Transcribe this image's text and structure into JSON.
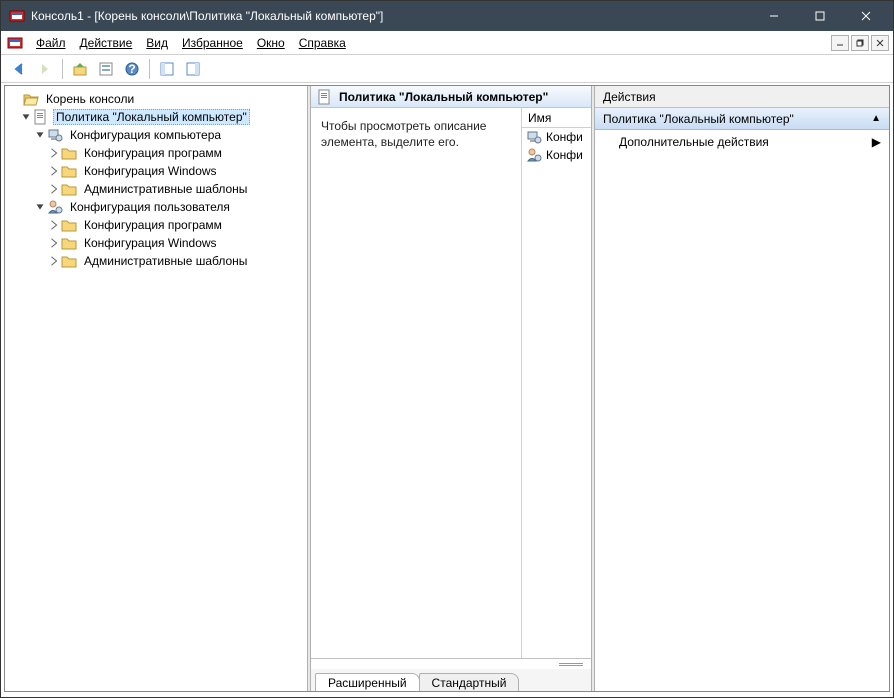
{
  "window": {
    "title": "Консоль1 - [Корень консоли\\Политика \"Локальный компьютер\"]"
  },
  "menu": {
    "file": "Файл",
    "action": "Действие",
    "view": "Вид",
    "fav": "Избранное",
    "window": "Окно",
    "help": "Справка"
  },
  "tree": {
    "root": "Корень консоли",
    "policy": "Политика \"Локальный компьютер\"",
    "comp_cfg": "Конфигурация компьютера",
    "user_cfg": "Конфигурация пользователя",
    "children": {
      "prog_cfg": "Конфигурация программ",
      "win_cfg": "Конфигурация Windows",
      "admin_tpl": "Административные шаблоны"
    }
  },
  "mid": {
    "header": "Политика \"Локальный компьютер\"",
    "desc": "Чтобы просмотреть описание элемента, выделите его.",
    "col_name": "Имя",
    "items": [
      "Конфи",
      "Конфи"
    ]
  },
  "tabs": {
    "ext": "Расширенный",
    "std": "Стандартный"
  },
  "actions": {
    "title": "Действия",
    "group": "Политика \"Локальный компьютер\"",
    "more": "Дополнительные действия"
  }
}
